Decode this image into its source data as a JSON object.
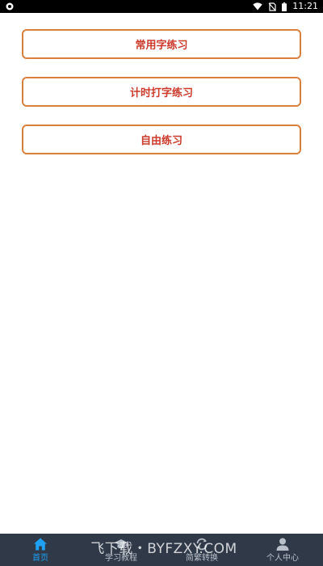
{
  "status_bar": {
    "time": "11:21",
    "icons": [
      "app-notification-icon",
      "wifi-icon",
      "no-sim-icon",
      "battery-icon"
    ]
  },
  "practice_buttons": [
    {
      "label": "常用字练习"
    },
    {
      "label": "计时打字练习"
    },
    {
      "label": "自由练习"
    }
  ],
  "bottom_nav": {
    "items": [
      {
        "label": "首页",
        "icon": "home-icon",
        "active": true
      },
      {
        "label": "学习教程",
        "icon": "graduation-cap-icon",
        "active": false
      },
      {
        "label": "简繁转换",
        "icon": "convert-icon",
        "active": false
      },
      {
        "label": "个人中心",
        "icon": "user-icon",
        "active": false
      }
    ]
  },
  "watermark": {
    "text": "飞下载・BYFZXY.COM"
  },
  "colors": {
    "button_border": "#d9803f",
    "button_text": "#cc3a2b",
    "nav_background": "#2f3948",
    "nav_active": "#1ea1f2",
    "nav_inactive": "#b9c0c9",
    "status_bar": "#000000"
  }
}
